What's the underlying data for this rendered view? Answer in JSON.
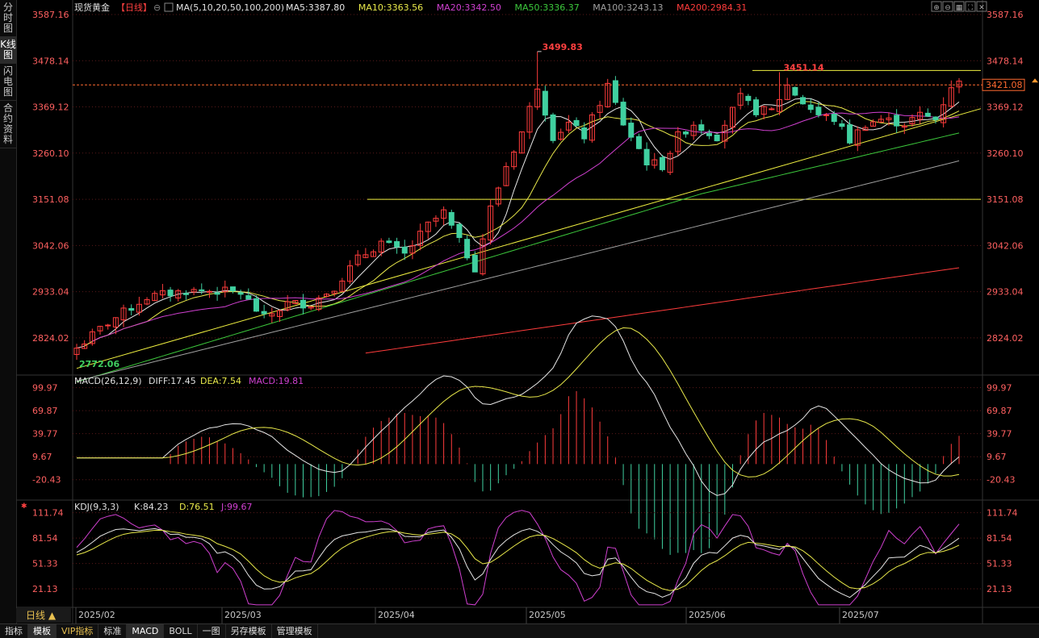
{
  "sidebar": {
    "tabs": [
      {
        "label": "分时图",
        "active": false
      },
      {
        "label": "K线图",
        "active": true
      },
      {
        "label": "闪电图",
        "active": false
      },
      {
        "label": "合约资料",
        "active": false
      }
    ]
  },
  "header": {
    "instrument": "现货黄金",
    "period": "【日线】",
    "ma_params": "MA(5,10,20,50,100,200)",
    "ma_values": [
      {
        "label": "MA5:3387.80",
        "color": "#e6e6e6"
      },
      {
        "label": "MA10:3363.56",
        "color": "#e8e84a"
      },
      {
        "label": "MA20:3342.50",
        "color": "#d040d0"
      },
      {
        "label": "MA50:3336.37",
        "color": "#3cc83c"
      },
      {
        "label": "MA100:3243.13",
        "color": "#a0a0a0"
      },
      {
        "label": "MA200:2984.31",
        "color": "#ff3c3c"
      }
    ]
  },
  "colors": {
    "up": "#ff3c3c",
    "down": "#40d0a0",
    "grid": "#5a1a1a",
    "axis_text": "#ff6060",
    "rise_text": "#ff4040"
  },
  "price_axis": {
    "ticks": [
      "3587.16",
      "3478.14",
      "3369.12",
      "3260.10",
      "3151.08",
      "3042.06",
      "2933.04",
      "2824.02"
    ],
    "tick_values": [
      3587.16,
      3478.14,
      3369.12,
      3260.1,
      3151.08,
      3042.06,
      2933.04,
      2824.02
    ],
    "min": 2740,
    "max": 3587.16
  },
  "current_price": {
    "label": "3421.08",
    "value": 3421.08
  },
  "annotations": {
    "high": "3499.83",
    "high2": "3451.14",
    "low": "2772.06",
    "high_value": 3499.83,
    "high2_value": 3451.14,
    "low_value": 2772.06,
    "support": 3151.08
  },
  "macd": {
    "label": "MACD(26,12,9)",
    "diff": "DIFF:17.45",
    "dea": "DEA:7.54",
    "macd": "MACD:19.81",
    "ticks": [
      "99.97",
      "69.87",
      "39.77",
      "9.67",
      "-20.43"
    ],
    "tick_values": [
      99.97,
      69.87,
      39.77,
      9.67,
      -20.43
    ],
    "min": -45,
    "max": 108
  },
  "kdj": {
    "label": "KDJ(9,3,3)",
    "k": "K:84.23",
    "d": "D:76.51",
    "j": "J:99.67",
    "ticks": [
      "111.74",
      "81.54",
      "51.33",
      "21.13"
    ],
    "tick_values": [
      111.74,
      81.54,
      51.33,
      21.13
    ],
    "min": 0,
    "max": 122
  },
  "time_axis": {
    "labels": [
      "2025/02",
      "2025/03",
      "2025/04",
      "2025/05",
      "2025/06",
      "2025/07"
    ]
  },
  "period_button": "日线 ▲",
  "bottom_tabs": [
    {
      "label": "指标",
      "active": false,
      "vip": false
    },
    {
      "label": "模板",
      "active": true,
      "vip": false
    },
    {
      "label": "VIP指标",
      "active": false,
      "vip": true
    },
    {
      "label": "标准",
      "active": false,
      "vip": false
    },
    {
      "label": "MACD",
      "active": true,
      "vip": false
    },
    {
      "label": "BOLL",
      "active": false,
      "vip": false
    },
    {
      "label": "一图",
      "active": false,
      "vip": false
    },
    {
      "label": "另存模板",
      "active": false,
      "vip": false
    },
    {
      "label": "管理模板",
      "active": false,
      "vip": false
    }
  ],
  "toolbar_icons": [
    "zoom-in-icon",
    "zoom-out-icon",
    "layout-icon",
    "fullscreen-icon",
    "close-icon"
  ]
}
